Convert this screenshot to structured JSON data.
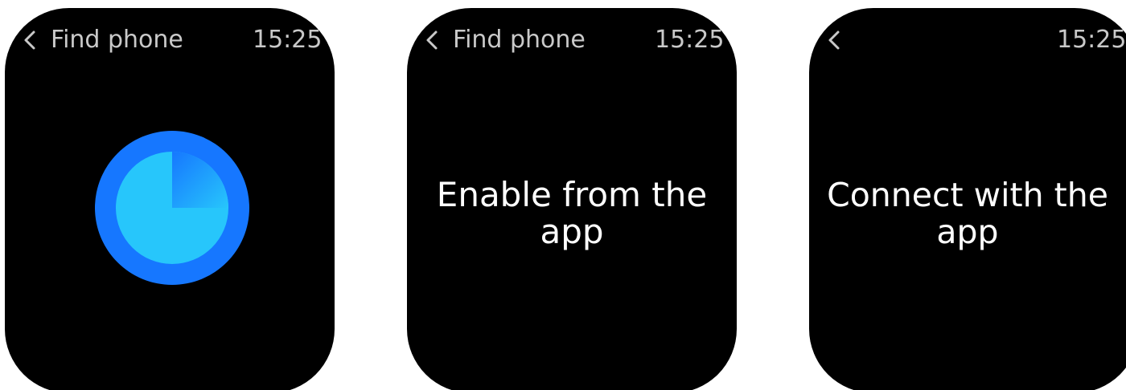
{
  "screens": [
    {
      "header": {
        "title": "Find phone",
        "time": "15:25",
        "back_icon": "chevron-left-icon"
      },
      "body": {
        "type": "radar",
        "icon": "find-phone-radar-icon",
        "colors": {
          "ring": "#1677ff",
          "disc": "#27c6fb",
          "sweep_start": "#1677ff",
          "sweep_end": "#27c6fb"
        }
      }
    },
    {
      "header": {
        "title": "Find phone",
        "time": "15:25",
        "back_icon": "chevron-left-icon"
      },
      "body": {
        "type": "message",
        "line1": "Enable from the",
        "line2": "app"
      }
    },
    {
      "header": {
        "title": "",
        "time": "15:25",
        "back_icon": "chevron-left-icon"
      },
      "body": {
        "type": "message",
        "line1": "Connect with the",
        "line2": "app"
      }
    }
  ],
  "colors": {
    "screen_background": "#000000",
    "header_text": "#c9c9c9",
    "message_text": "#ffffff"
  }
}
